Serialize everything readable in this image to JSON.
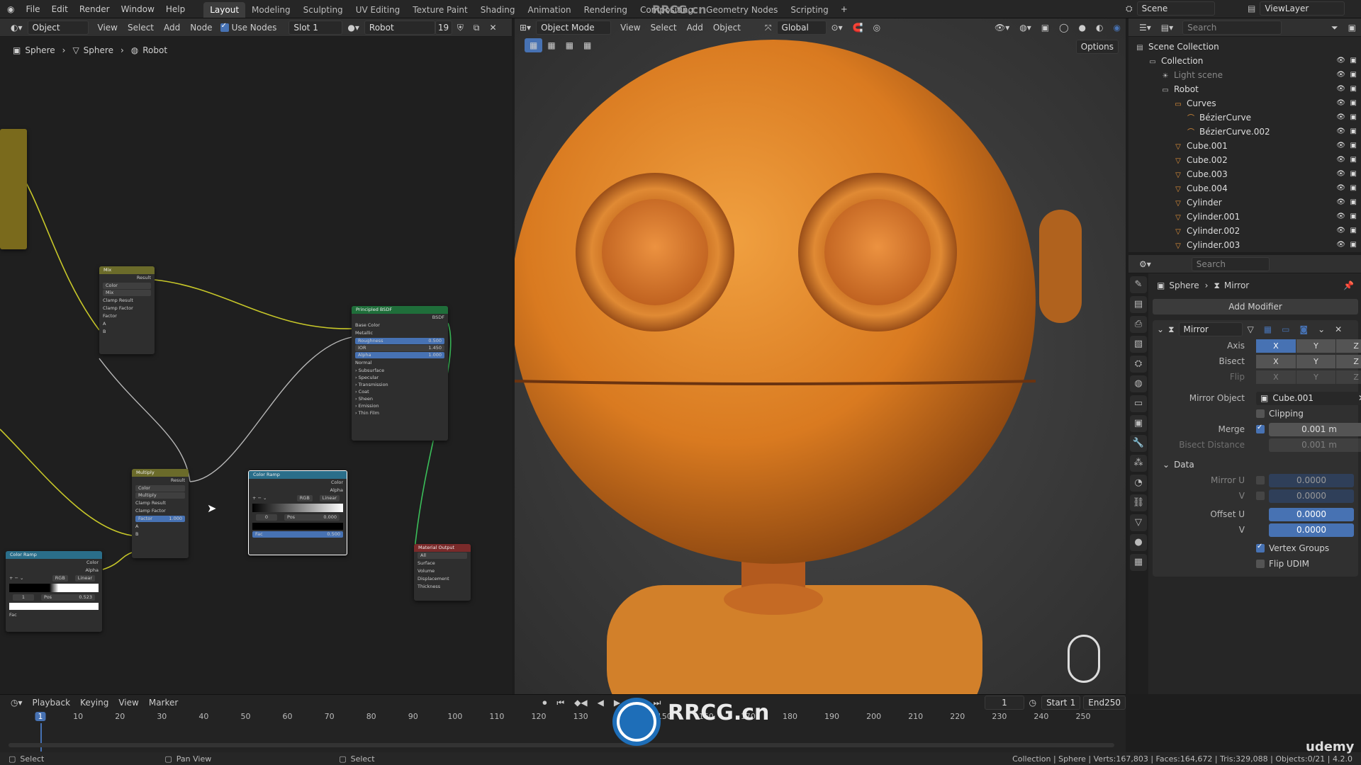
{
  "app": {
    "menu": [
      "File",
      "Edit",
      "Render",
      "Window",
      "Help"
    ],
    "workspaces": [
      "Layout",
      "Modeling",
      "Sculpting",
      "UV Editing",
      "Texture Paint",
      "Shading",
      "Animation",
      "Rendering",
      "Compositing",
      "Geometry Nodes",
      "Scripting"
    ],
    "active_workspace": "Layout",
    "scene_name": "Scene",
    "view_layer": "ViewLayer",
    "watermark": "RRCG.cn"
  },
  "node_editor": {
    "header": {
      "mode": "Object",
      "view": "View",
      "select": "Select",
      "add": "Add",
      "node": "Node",
      "use_nodes_label": "Use Nodes",
      "slot": "Slot 1",
      "material": "Robot",
      "users": "19"
    },
    "breadcrumb": [
      "Sphere",
      "Sphere",
      "Robot"
    ],
    "nodes": {
      "mix": {
        "title": "Mix",
        "output": "Result",
        "data_type": "Color",
        "blend": "Mix",
        "clamp_result": "Clamp Result",
        "clamp_factor": "Clamp Factor",
        "factor": "Factor",
        "a": "A",
        "b": "B"
      },
      "bsdf": {
        "title": "Principled BSDF",
        "output": "BSDF",
        "base_color": "Base Color",
        "metallic": "Metallic",
        "roughness": "Roughness",
        "roughness_val": "0.500",
        "ior": "IOR",
        "ior_val": "1.450",
        "alpha": "Alpha",
        "alpha_val": "1.000",
        "normal": "Normal",
        "panels": [
          "Subsurface",
          "Specular",
          "Transmission",
          "Coat",
          "Sheen",
          "Emission",
          "Thin Film"
        ]
      },
      "multiply": {
        "title": "Multiply",
        "output": "Result",
        "data_type": "Color",
        "blend": "Multiply",
        "clamp_result": "Clamp Result",
        "clamp_factor": "Clamp Factor",
        "factor": "Factor",
        "factor_val": "1.000",
        "a": "A",
        "b": "B"
      },
      "ramp1": {
        "title": "Color Ramp",
        "color": "Color",
        "alpha": "Alpha",
        "mode": "RGB",
        "interp": "Linear",
        "index": "0",
        "pos": "Pos",
        "pos_val": "0.000",
        "fac": "Fac",
        "fac_val": "0.500"
      },
      "ramp2": {
        "title": "Color Ramp",
        "color": "Color",
        "alpha": "Alpha",
        "mode": "RGB",
        "interp": "Linear",
        "index": "1",
        "pos": "Pos",
        "pos_val": "0.523",
        "fac": "Fac"
      },
      "output": {
        "title": "Material Output",
        "target": "All",
        "surface": "Surface",
        "volume": "Volume",
        "displacement": "Displacement",
        "thickness": "Thickness"
      }
    }
  },
  "viewport": {
    "mode": "Object Mode",
    "view": "View",
    "select": "Select",
    "add": "Add",
    "object": "Object",
    "orientation": "Global",
    "options": "Options"
  },
  "outliner": {
    "search_placeholder": "Search",
    "items": [
      {
        "label": "Scene Collection",
        "indent": 0
      },
      {
        "label": "Collection",
        "indent": 1
      },
      {
        "label": "Light scene",
        "indent": 2
      },
      {
        "label": "Robot",
        "indent": 2
      },
      {
        "label": "Curves",
        "indent": 3
      },
      {
        "label": "BézierCurve",
        "indent": 4
      },
      {
        "label": "BézierCurve.002",
        "indent": 4
      },
      {
        "label": "Cube.001",
        "indent": 3
      },
      {
        "label": "Cube.002",
        "indent": 3
      },
      {
        "label": "Cube.003",
        "indent": 3
      },
      {
        "label": "Cube.004",
        "indent": 3
      },
      {
        "label": "Cylinder",
        "indent": 3
      },
      {
        "label": "Cylinder.001",
        "indent": 3
      },
      {
        "label": "Cylinder.002",
        "indent": 3
      },
      {
        "label": "Cylinder.003",
        "indent": 3
      }
    ]
  },
  "properties": {
    "search_placeholder": "Search",
    "breadcrumb_object": "Sphere",
    "breadcrumb_modifier": "Mirror",
    "add_modifier": "Add Modifier",
    "modifier_name": "Mirror",
    "axis_label": "Axis",
    "bisect_label": "Bisect",
    "flip_label": "Flip",
    "axes": [
      "X",
      "Y",
      "Z"
    ],
    "mirror_object_label": "Mirror Object",
    "mirror_object": "Cube.001",
    "clipping": "Clipping",
    "merge_label": "Merge",
    "merge_val": "0.001 m",
    "bisect_distance_label": "Bisect Distance",
    "bisect_distance_val": "0.001 m",
    "data_panel": "Data",
    "mirror_u_label": "Mirror U",
    "mirror_u_val": "0.0000",
    "v_label": "V",
    "mirror_v_val": "0.0000",
    "offset_u_label": "Offset U",
    "offset_u_val": "0.0000",
    "offset_v_val": "0.0000",
    "vertex_groups": "Vertex Groups",
    "flip_udim": "Flip UDIM"
  },
  "timeline": {
    "playback": "Playback",
    "keying": "Keying",
    "view": "View",
    "marker": "Marker",
    "current_frame": "1",
    "start_label": "Start",
    "start": "1",
    "end_label": "End",
    "end": "250",
    "ticks": [
      "1",
      "10",
      "20",
      "30",
      "40",
      "50",
      "60",
      "70",
      "80",
      "90",
      "100",
      "110",
      "120",
      "130",
      "140",
      "150",
      "160",
      "170",
      "180",
      "190",
      "200",
      "210",
      "220",
      "230",
      "240",
      "250"
    ]
  },
  "status": {
    "left1": "Select",
    "left2": "Pan View",
    "left3": "Select",
    "right": "Collection | Sphere | Verts:167,803 | Faces:164,672 | Tris:329,088 | Objects:0/21 | 4.2.0",
    "brand": "udemy"
  },
  "colors": {
    "accent": "#4772b3",
    "robot_orange": "#e08a2a",
    "node_wire": "#c7c729"
  }
}
